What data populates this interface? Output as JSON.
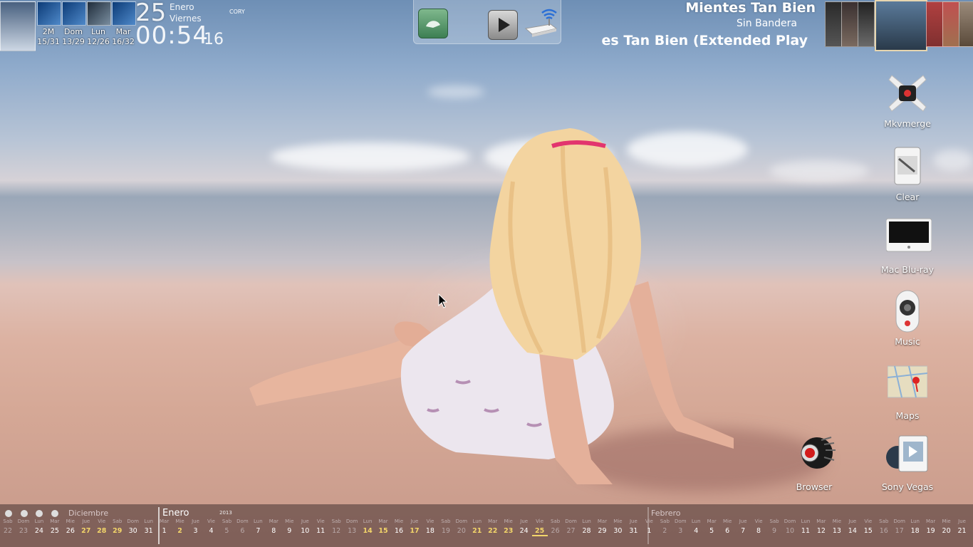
{
  "weather": {
    "days": [
      {
        "label": "2M",
        "temps": "15/31"
      },
      {
        "label": "Dom",
        "temps": "13/29"
      },
      {
        "label": "Lun",
        "temps": "12/26"
      },
      {
        "label": "Mar",
        "temps": "16/32"
      }
    ],
    "tag": "CORY"
  },
  "clock": {
    "date": "25",
    "month": "Enero",
    "weekday": "Viernes",
    "time": "00:54",
    "seconds": "16"
  },
  "now_playing": {
    "title": "Mientes Tan Bien",
    "artist": "Sin Bandera",
    "album": "Mientes Tan Bien (Extended Play"
  },
  "desktop_icons": [
    {
      "label": "Mkvmerge"
    },
    {
      "label": "Clear"
    },
    {
      "label": "Mac Blu-ray"
    },
    {
      "label": "Music"
    },
    {
      "label": "Maps"
    },
    {
      "label": "Browser"
    },
    {
      "label": "Sony Vegas"
    }
  ],
  "calendar": {
    "prev_month": "Diciembre",
    "current_month": "Enero",
    "year": "2013",
    "next_month": "Febrero",
    "cells": [
      {
        "dw": "Sab",
        "dn": "22",
        "state": "dim"
      },
      {
        "dw": "Dom",
        "dn": "23",
        "state": "dim"
      },
      {
        "dw": "Lun",
        "dn": "24",
        "state": "normal"
      },
      {
        "dw": "Mar",
        "dn": "25",
        "state": "normal"
      },
      {
        "dw": "Mie",
        "dn": "26",
        "state": "normal"
      },
      {
        "dw": "Jue",
        "dn": "27",
        "state": "hl"
      },
      {
        "dw": "Vie",
        "dn": "28",
        "state": "hl"
      },
      {
        "dw": "Sab",
        "dn": "29",
        "state": "hl"
      },
      {
        "dw": "Dom",
        "dn": "30",
        "state": "normal"
      },
      {
        "dw": "Lun",
        "dn": "31",
        "state": "normal"
      },
      {
        "dw": "Mar",
        "dn": "1",
        "state": "normal"
      },
      {
        "dw": "Mie",
        "dn": "2",
        "state": "hl"
      },
      {
        "dw": "Jue",
        "dn": "3",
        "state": "normal"
      },
      {
        "dw": "Vie",
        "dn": "4",
        "state": "normal"
      },
      {
        "dw": "Sab",
        "dn": "5",
        "state": "dim"
      },
      {
        "dw": "Dom",
        "dn": "6",
        "state": "dim"
      },
      {
        "dw": "Lun",
        "dn": "7",
        "state": "normal"
      },
      {
        "dw": "Mar",
        "dn": "8",
        "state": "normal"
      },
      {
        "dw": "Mie",
        "dn": "9",
        "state": "normal"
      },
      {
        "dw": "Jue",
        "dn": "10",
        "state": "normal"
      },
      {
        "dw": "Vie",
        "dn": "11",
        "state": "normal"
      },
      {
        "dw": "Sab",
        "dn": "12",
        "state": "dim"
      },
      {
        "dw": "Dom",
        "dn": "13",
        "state": "dim"
      },
      {
        "dw": "Lun",
        "dn": "14",
        "state": "hl"
      },
      {
        "dw": "Mar",
        "dn": "15",
        "state": "hl"
      },
      {
        "dw": "Mie",
        "dn": "16",
        "state": "normal"
      },
      {
        "dw": "Jue",
        "dn": "17",
        "state": "hl"
      },
      {
        "dw": "Vie",
        "dn": "18",
        "state": "normal"
      },
      {
        "dw": "Sab",
        "dn": "19",
        "state": "dim"
      },
      {
        "dw": "Dom",
        "dn": "20",
        "state": "dim"
      },
      {
        "dw": "Lun",
        "dn": "21",
        "state": "hl"
      },
      {
        "dw": "Mar",
        "dn": "22",
        "state": "hl"
      },
      {
        "dw": "Mie",
        "dn": "23",
        "state": "hl"
      },
      {
        "dw": "Jue",
        "dn": "24",
        "state": "normal"
      },
      {
        "dw": "Vie",
        "dn": "25",
        "state": "today"
      },
      {
        "dw": "Sab",
        "dn": "26",
        "state": "dim"
      },
      {
        "dw": "Dom",
        "dn": "27",
        "state": "dim"
      },
      {
        "dw": "Lun",
        "dn": "28",
        "state": "normal"
      },
      {
        "dw": "Mar",
        "dn": "29",
        "state": "normal"
      },
      {
        "dw": "Mie",
        "dn": "30",
        "state": "normal"
      },
      {
        "dw": "Jue",
        "dn": "31",
        "state": "normal"
      },
      {
        "dw": "Vie",
        "dn": "1",
        "state": "normal"
      },
      {
        "dw": "Sab",
        "dn": "2",
        "state": "dim"
      },
      {
        "dw": "Dom",
        "dn": "3",
        "state": "dim"
      },
      {
        "dw": "Lun",
        "dn": "4",
        "state": "normal"
      },
      {
        "dw": "Mar",
        "dn": "5",
        "state": "normal"
      },
      {
        "dw": "Mie",
        "dn": "6",
        "state": "normal"
      },
      {
        "dw": "Jue",
        "dn": "7",
        "state": "normal"
      },
      {
        "dw": "Vie",
        "dn": "8",
        "state": "normal"
      },
      {
        "dw": "Sab",
        "dn": "9",
        "state": "dim"
      },
      {
        "dw": "Dom",
        "dn": "10",
        "state": "dim"
      },
      {
        "dw": "Lun",
        "dn": "11",
        "state": "normal"
      },
      {
        "dw": "Mar",
        "dn": "12",
        "state": "normal"
      },
      {
        "dw": "Mie",
        "dn": "13",
        "state": "normal"
      },
      {
        "dw": "Jue",
        "dn": "14",
        "state": "normal"
      },
      {
        "dw": "Vie",
        "dn": "15",
        "state": "normal"
      },
      {
        "dw": "Sab",
        "dn": "16",
        "state": "dim"
      },
      {
        "dw": "Dom",
        "dn": "17",
        "state": "dim"
      },
      {
        "dw": "Lun",
        "dn": "18",
        "state": "normal"
      },
      {
        "dw": "Mar",
        "dn": "19",
        "state": "normal"
      },
      {
        "dw": "Mie",
        "dn": "20",
        "state": "normal"
      },
      {
        "dw": "Jue",
        "dn": "21",
        "state": "normal"
      }
    ]
  },
  "colors": {
    "highlight_day": "#f2d56a",
    "calendar_bar": "#463232"
  }
}
